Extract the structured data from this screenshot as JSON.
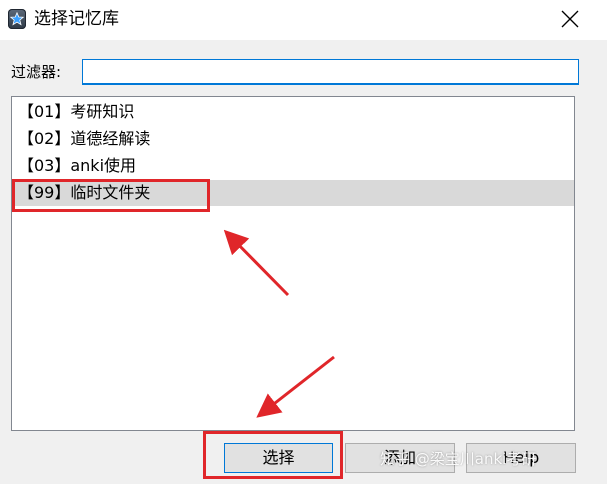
{
  "window": {
    "title": "选择记忆库",
    "app_icon": "star-app-icon",
    "close_icon": "close-icon"
  },
  "filter": {
    "label": "过滤器:",
    "value": ""
  },
  "decks": [
    {
      "label": "【01】考研知识",
      "selected": false
    },
    {
      "label": "【02】道德经解读",
      "selected": false
    },
    {
      "label": "【03】anki使用",
      "selected": false
    },
    {
      "label": "【99】临时文件夹",
      "selected": true
    }
  ],
  "buttons": {
    "select": "选择",
    "add": "添加",
    "help": "Help"
  },
  "annotations": {
    "highlight_color": "#e0262a",
    "watermark": "知乎 @梁宝川anki考研"
  },
  "colors": {
    "selection": "#d9d9d9",
    "focus_border": "#0078d7"
  }
}
